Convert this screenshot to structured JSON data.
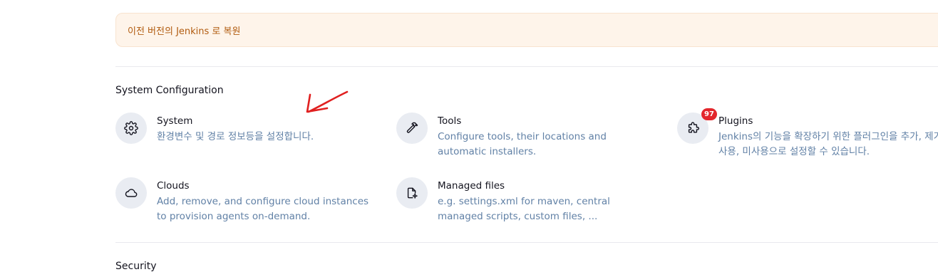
{
  "notice": {
    "text": "이전 버전의 Jenkins 로 복원"
  },
  "system_configuration": {
    "title": "System Configuration",
    "items": [
      {
        "icon": "gear-icon",
        "title": "System",
        "description": "환경변수 및 경로 정보등을 설정합니다."
      },
      {
        "icon": "hammer-icon",
        "title": "Tools",
        "description": "Configure tools, their locations and automatic installers."
      },
      {
        "icon": "puzzle-icon",
        "title": "Plugins",
        "description": "Jenkins의 기능을 확장하기 위한 플러그인을 추가, 제거, 사용, 미사용으로 설정할 수 있습니다.",
        "badge": "97"
      },
      {
        "icon": "cloud-icon",
        "title": "Clouds",
        "description": "Add, remove, and configure cloud instances to provision agents on-demand."
      },
      {
        "icon": "file-gear-icon",
        "title": "Managed files",
        "description": "e.g. settings.xml for maven, central managed scripts, custom files, ..."
      }
    ]
  },
  "security": {
    "title": "Security"
  },
  "colors": {
    "badge": "#e3262c",
    "description": "#6181a6",
    "notice_text": "#b15b0f",
    "annotation_arrow": "#e02020"
  }
}
